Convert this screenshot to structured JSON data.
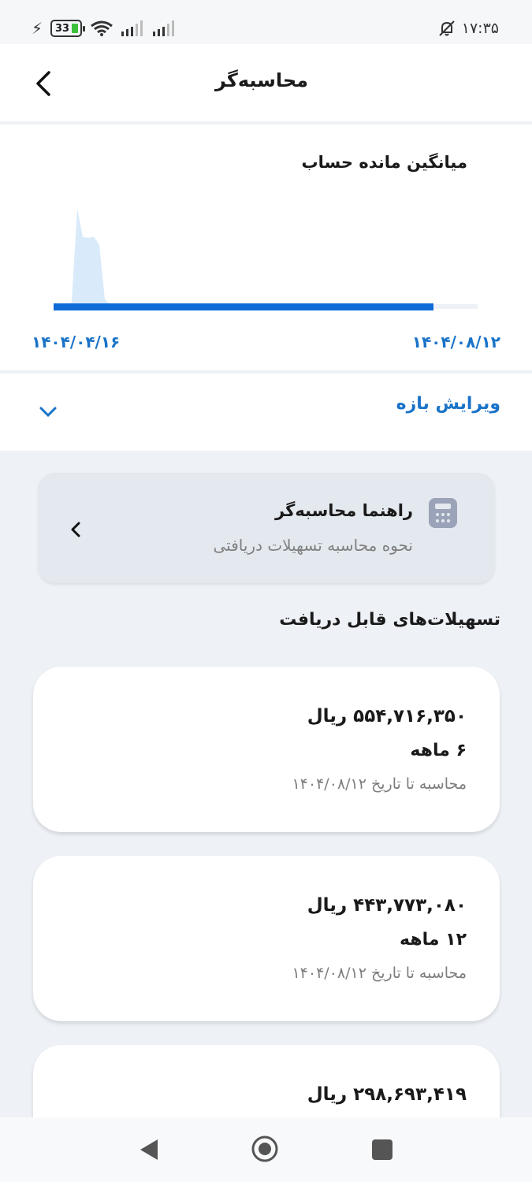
{
  "status_bar": {
    "battery": "33",
    "time": "۱۷:۳۵"
  },
  "header": {
    "title": "محاسبه‌گر"
  },
  "chart_data": {
    "type": "area",
    "title": "میانگین مانده حساب",
    "x_start_label": "۱۴۰۴/۰۴/۱۶",
    "x_end_label": "۱۴۰۴/۰۸/۱۲",
    "selected_range": [
      "۱۴۰۴/۰۴/۱۶",
      "۱۴۰۴/۰۸/۱۲"
    ],
    "series": [
      {
        "values": [
          0,
          0.02,
          1.0,
          0.7,
          0.69,
          0.7,
          0.62,
          0.05,
          0,
          0
        ]
      }
    ]
  },
  "edit_range": {
    "label": "ویرایش بازه"
  },
  "guide": {
    "title": "راهنما محاسبه‌گر",
    "subtitle": "نحوه محاسبه تسهیلات دریافتی"
  },
  "section_title": "تسهیلات‌های قابل دریافت",
  "loans": [
    {
      "amount": "۵۵۴,۷۱۶,۳۵۰ ریال",
      "term": "۶ ماهه",
      "date_note": "محاسبه تا تاریخ ۱۴۰۴/۰۸/۱۲"
    },
    {
      "amount": "۴۴۳,۷۷۳,۰۸۰ ریال",
      "term": "۱۲ ماهه",
      "date_note": "محاسبه تا تاریخ ۱۴۰۴/۰۸/۱۲"
    },
    {
      "amount": "۲۹۸,۶۹۳,۴۱۹ ریال",
      "term": "",
      "date_note": ""
    }
  ],
  "colors": {
    "accent": "#1a73c8",
    "bar": "#0f6bd7",
    "area": "#d9ebfb",
    "background": "#eef1f6"
  }
}
